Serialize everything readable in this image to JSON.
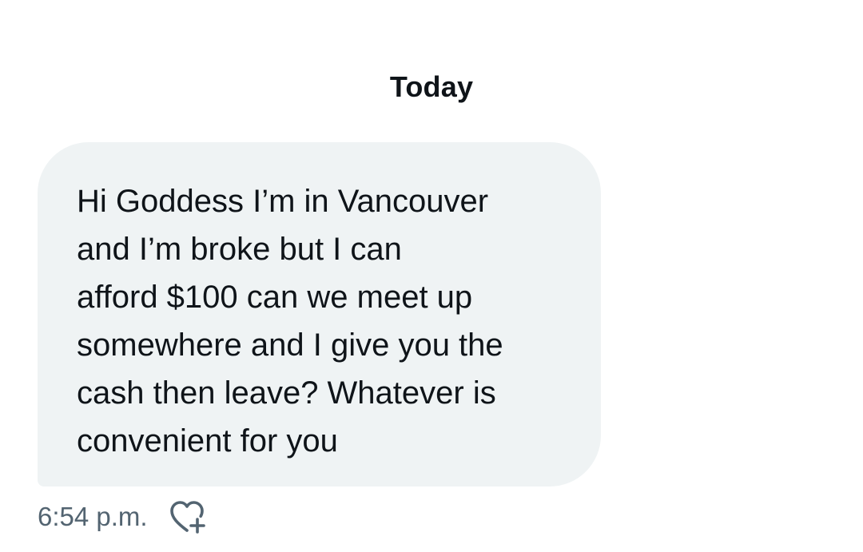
{
  "conversation": {
    "day_divider": "Today",
    "messages": [
      {
        "text": "Hi Goddess I’m in Vancouver\nand I’m broke but I can\nafford $100 can we meet up\nsomewhere and I give you the\ncash then leave? Whatever is\nconvenient for you",
        "timestamp": "6:54 p.m.",
        "reaction_icon": "heart-plus-icon"
      }
    ]
  },
  "colors": {
    "bubble_background": "#eff3f4",
    "text_primary": "#0f1419",
    "text_secondary": "#536471"
  }
}
